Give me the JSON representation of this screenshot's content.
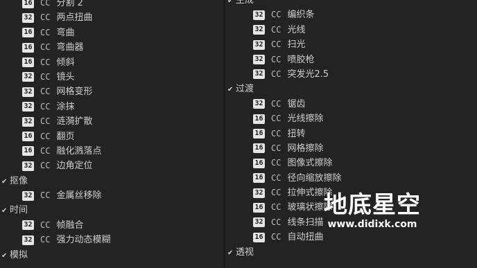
{
  "left_tree": [
    {
      "kind": "item",
      "badge": "16",
      "cc": "CC",
      "label": "分割 2"
    },
    {
      "kind": "item",
      "badge": "32",
      "cc": "CC",
      "label": "两点扭曲"
    },
    {
      "kind": "item",
      "badge": "16",
      "cc": "CC",
      "label": "弯曲"
    },
    {
      "kind": "item",
      "badge": "16",
      "cc": "CC",
      "label": "弯曲器"
    },
    {
      "kind": "item",
      "badge": "16",
      "cc": "CC",
      "label": "倾斜"
    },
    {
      "kind": "item",
      "badge": "32",
      "cc": "CC",
      "label": "镜头"
    },
    {
      "kind": "item",
      "badge": "32",
      "cc": "CC",
      "label": "网格变形"
    },
    {
      "kind": "item",
      "badge": "32",
      "cc": "CC",
      "label": "涂抹"
    },
    {
      "kind": "item",
      "badge": "32",
      "cc": "CC",
      "label": "涟漪扩散"
    },
    {
      "kind": "item",
      "badge": "16",
      "cc": "CC",
      "label": "翻页"
    },
    {
      "kind": "item",
      "badge": "16",
      "cc": "CC",
      "label": "融化溅落点"
    },
    {
      "kind": "item",
      "badge": "32",
      "cc": "CC",
      "label": "边角定位"
    },
    {
      "kind": "group",
      "label": "抠像"
    },
    {
      "kind": "item",
      "badge": "32",
      "cc": "CC",
      "label": "金属丝移除"
    },
    {
      "kind": "group",
      "label": "时间"
    },
    {
      "kind": "item",
      "badge": "32",
      "cc": "CC",
      "label": "帧融合"
    },
    {
      "kind": "item",
      "badge": "32",
      "cc": "CC",
      "label": "强力动态模糊"
    },
    {
      "kind": "group",
      "label": "模拟"
    }
  ],
  "right_tree": [
    {
      "kind": "group",
      "label": "生成"
    },
    {
      "kind": "item",
      "badge": "32",
      "cc": "CC",
      "label": "编织条"
    },
    {
      "kind": "item",
      "badge": "32",
      "cc": "CC",
      "label": "光线"
    },
    {
      "kind": "item",
      "badge": "32",
      "cc": "CC",
      "label": "扫光"
    },
    {
      "kind": "item",
      "badge": "32",
      "cc": "CC",
      "label": "喷胶枪"
    },
    {
      "kind": "item",
      "badge": "32",
      "cc": "CC",
      "label": "突发光2.5"
    },
    {
      "kind": "group",
      "label": "过渡"
    },
    {
      "kind": "item",
      "badge": "32",
      "cc": "CC",
      "label": "锯齿"
    },
    {
      "kind": "item",
      "badge": "16",
      "cc": "CC",
      "label": "光线擦除"
    },
    {
      "kind": "item",
      "badge": "16",
      "cc": "CC",
      "label": "扭转"
    },
    {
      "kind": "item",
      "badge": "16",
      "cc": "CC",
      "label": "网格擦除"
    },
    {
      "kind": "item",
      "badge": "16",
      "cc": "CC",
      "label": "图像式擦除"
    },
    {
      "kind": "item",
      "badge": "16",
      "cc": "CC",
      "label": "径向缩放擦除"
    },
    {
      "kind": "item",
      "badge": "32",
      "cc": "CC",
      "label": "拉伸式擦除"
    },
    {
      "kind": "item",
      "badge": "16",
      "cc": "CC",
      "label": "玻璃状擦除"
    },
    {
      "kind": "item",
      "badge": "32",
      "cc": "CC",
      "label": "线条扫描"
    },
    {
      "kind": "item",
      "badge": "16",
      "cc": "CC",
      "label": "自动扭曲"
    },
    {
      "kind": "group",
      "label": "透视"
    }
  ],
  "watermark": {
    "title": "地底星空",
    "url": "www.didixk.com"
  }
}
